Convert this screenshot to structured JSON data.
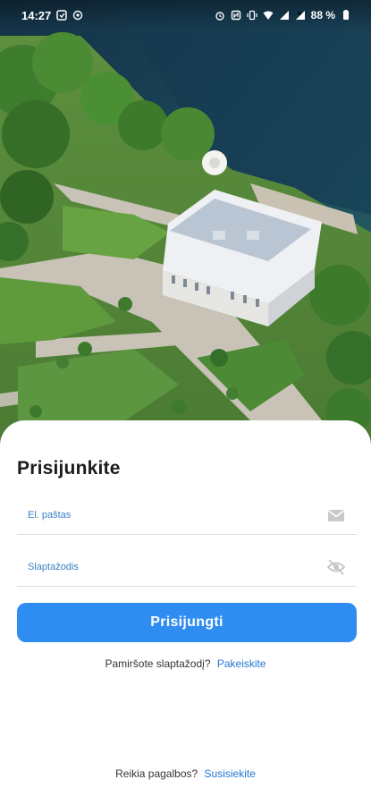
{
  "status_bar": {
    "time": "14:27",
    "battery": "88 %"
  },
  "hero": {
    "image_icon": "aerial-manor-image"
  },
  "login": {
    "title": "Prisijunkite",
    "email_placeholder": "El. paštas",
    "password_placeholder": "Slaptažodis",
    "email_icon": "mail-icon",
    "password_icon": "eye-off-icon",
    "submit_label": "Prisijungti",
    "forgot_text": "Pamiršote slaptažodį?",
    "forgot_link": "Pakeiskite",
    "help_text": "Reikia pagalbos?",
    "help_link": "Susisiekite"
  },
  "colors": {
    "accent": "#2f8cf0",
    "link": "#1f77d0"
  }
}
